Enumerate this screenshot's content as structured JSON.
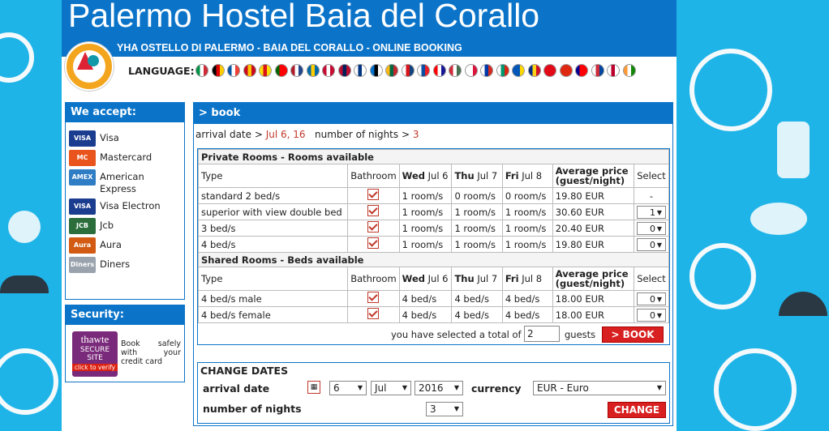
{
  "header": {
    "title": "Palermo Hostel Baia del Corallo",
    "subtitle": "YHA OSTELLO DI PALERMO - BAIA DEL CORALLO - ONLINE BOOKING",
    "language_label": "LANGUAGE:"
  },
  "flags": [
    {
      "name": "italian",
      "c1": "#009246",
      "c2": "#ffffff",
      "c3": "#ce2b37"
    },
    {
      "name": "german",
      "c1": "#000000",
      "c2": "#dd0000",
      "c3": "#ffce00"
    },
    {
      "name": "french",
      "c1": "#0055a4",
      "c2": "#ffffff",
      "c3": "#ef4135"
    },
    {
      "name": "spanish",
      "c1": "#c60b1e",
      "c2": "#ffc400",
      "c3": "#c60b1e"
    },
    {
      "name": "catalan",
      "c1": "#fcdd09",
      "c2": "#da121a",
      "c3": "#fcdd09"
    },
    {
      "name": "portuguese",
      "c1": "#006600",
      "c2": "#ff0000",
      "c3": "#ff0000"
    },
    {
      "name": "dutch",
      "c1": "#ae1c28",
      "c2": "#ffffff",
      "c3": "#21468b"
    },
    {
      "name": "swedish",
      "c1": "#006aa7",
      "c2": "#fecc00",
      "c3": "#006aa7"
    },
    {
      "name": "danish",
      "c1": "#c60c30",
      "c2": "#ffffff",
      "c3": "#c60c30"
    },
    {
      "name": "norwegian",
      "c1": "#ba0c2f",
      "c2": "#00205b",
      "c3": "#ba0c2f"
    },
    {
      "name": "finnish",
      "c1": "#ffffff",
      "c2": "#003580",
      "c3": "#ffffff"
    },
    {
      "name": "estonian",
      "c1": "#0072ce",
      "c2": "#000000",
      "c3": "#ffffff"
    },
    {
      "name": "lithuanian",
      "c1": "#fdb913",
      "c2": "#006a44",
      "c3": "#c1272d"
    },
    {
      "name": "czech",
      "c1": "#ffffff",
      "c2": "#d7141a",
      "c3": "#11457e"
    },
    {
      "name": "slovak",
      "c1": "#ffffff",
      "c2": "#0b4ea2",
      "c3": "#ee1c25"
    },
    {
      "name": "croatian",
      "c1": "#ff0000",
      "c2": "#ffffff",
      "c3": "#171796"
    },
    {
      "name": "hungarian",
      "c1": "#ce2939",
      "c2": "#ffffff",
      "c3": "#477050"
    },
    {
      "name": "polish",
      "c1": "#ffffff",
      "c2": "#ffffff",
      "c3": "#dc143c"
    },
    {
      "name": "russian",
      "c1": "#ffffff",
      "c2": "#0039a6",
      "c3": "#d52b1e"
    },
    {
      "name": "bulgarian",
      "c1": "#ffffff",
      "c2": "#00966e",
      "c3": "#d62612"
    },
    {
      "name": "ukrainian",
      "c1": "#0057b7",
      "c2": "#0057b7",
      "c3": "#ffd700"
    },
    {
      "name": "romanian",
      "c1": "#002b7f",
      "c2": "#fcd116",
      "c3": "#ce1126"
    },
    {
      "name": "turkish",
      "c1": "#e30a17",
      "c2": "#e30a17",
      "c3": "#e30a17"
    },
    {
      "name": "chinese",
      "c1": "#de2910",
      "c2": "#de2910",
      "c3": "#de2910"
    },
    {
      "name": "taiwanese",
      "c1": "#000095",
      "c2": "#fe0000",
      "c3": "#fe0000"
    },
    {
      "name": "korean",
      "c1": "#ffffff",
      "c2": "#cd2e3a",
      "c3": "#0047a0"
    },
    {
      "name": "japanese",
      "c1": "#ffffff",
      "c2": "#bc002d",
      "c3": "#ffffff"
    },
    {
      "name": "indian",
      "c1": "#ff9933",
      "c2": "#ffffff",
      "c3": "#138808"
    }
  ],
  "accept": {
    "title": "We accept:",
    "items": [
      {
        "label": "Visa",
        "card": "VISA",
        "color": "#1a3d8f"
      },
      {
        "label": "Mastercard",
        "card": "MC",
        "color": "#e8541b"
      },
      {
        "label": "American Express",
        "card": "AMEX",
        "color": "#2f7dc4"
      },
      {
        "label": "Visa Electron",
        "card": "VISA",
        "color": "#1a3d8f"
      },
      {
        "label": "Jcb",
        "card": "JCB",
        "color": "#2b6e3c"
      },
      {
        "label": "Aura",
        "card": "Aura",
        "color": "#d25a12"
      },
      {
        "label": "Diners",
        "card": "Diners",
        "color": "#9aa3ad"
      }
    ]
  },
  "security": {
    "title": "Security:",
    "badge_brand": "thawte",
    "badge_line1": "SECURE",
    "badge_line2": "SITE",
    "badge_line3": "click to verify",
    "text": "Book safely with your credit card"
  },
  "book": {
    "header": "> book",
    "arrival_label": "arrival date >",
    "arrival_value": "Jul 6, 16",
    "nights_label": "number of nights >",
    "nights_value": "3",
    "private": {
      "section": "Private Rooms - Rooms available",
      "headers": {
        "type": "Type",
        "bathroom": "Bathroom",
        "d1_bold": "Wed",
        "d1": "Jul 6",
        "d2_bold": "Thu",
        "d2": "Jul 7",
        "d3_bold": "Fri",
        "d3": "Jul 8",
        "avg1": "Average price",
        "avg2": "(guest/night)",
        "select": "Select"
      },
      "rows": [
        {
          "type": "standard 2 bed/s",
          "d1": "1 room/s",
          "d2": "0 room/s",
          "d3": "0 room/s",
          "price": "19.80 EUR",
          "select": "-"
        },
        {
          "type": "superior with view double bed",
          "d1": "1 room/s",
          "d2": "1 room/s",
          "d3": "1 room/s",
          "price": "30.60 EUR",
          "select": "1"
        },
        {
          "type": "3 bed/s",
          "d1": "1 room/s",
          "d2": "1 room/s",
          "d3": "1 room/s",
          "price": "20.40 EUR",
          "select": "0"
        },
        {
          "type": "4 bed/s",
          "d1": "1 room/s",
          "d2": "1 room/s",
          "d3": "1 room/s",
          "price": "19.80 EUR",
          "select": "0"
        }
      ]
    },
    "shared": {
      "section": "Shared Rooms - Beds available",
      "rows": [
        {
          "type": "4 bed/s male",
          "d1": "4 bed/s",
          "d2": "4 bed/s",
          "d3": "4 bed/s",
          "price": "18.00 EUR",
          "select": "0"
        },
        {
          "type": "4 bed/s female",
          "d1": "4 bed/s",
          "d2": "4 bed/s",
          "d3": "4 bed/s",
          "price": "18.00 EUR",
          "select": "0"
        }
      ]
    },
    "total_text": "you have selected a total of",
    "guests_value": "2",
    "guests_label": "guests",
    "book_button": "> BOOK"
  },
  "change": {
    "title": "CHANGE DATES",
    "arrival_label": "arrival date",
    "day": "6",
    "month": "Jul",
    "year": "2016",
    "currency_label": "currency",
    "currency_value": "EUR - Euro",
    "nights_label": "number of nights",
    "nights_value": "3",
    "change_button": "CHANGE"
  },
  "arrow_glyph": "▼"
}
